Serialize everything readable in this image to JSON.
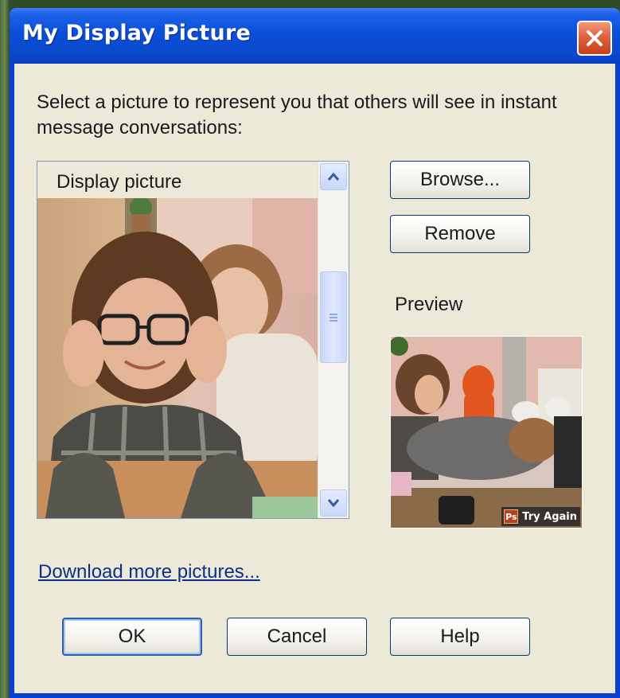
{
  "window": {
    "title": "My Display Picture",
    "close_icon": "close-icon"
  },
  "instructions": "Select a picture to represent you that others will see in instant message conversations:",
  "picture_list": {
    "header": "Display picture"
  },
  "buttons": {
    "browse": "Browse...",
    "remove": "Remove",
    "ok": "OK",
    "cancel": "Cancel",
    "help": "Help"
  },
  "preview": {
    "label": "Preview",
    "badge": "Try Again",
    "badge_icon_text": "Ps"
  },
  "download_link": "Download more pictures...",
  "colors": {
    "titlebar": "#0b4fd8",
    "dialog_face": "#ece9d8",
    "close_button": "#e0623c",
    "link": "#0b2f8a"
  }
}
